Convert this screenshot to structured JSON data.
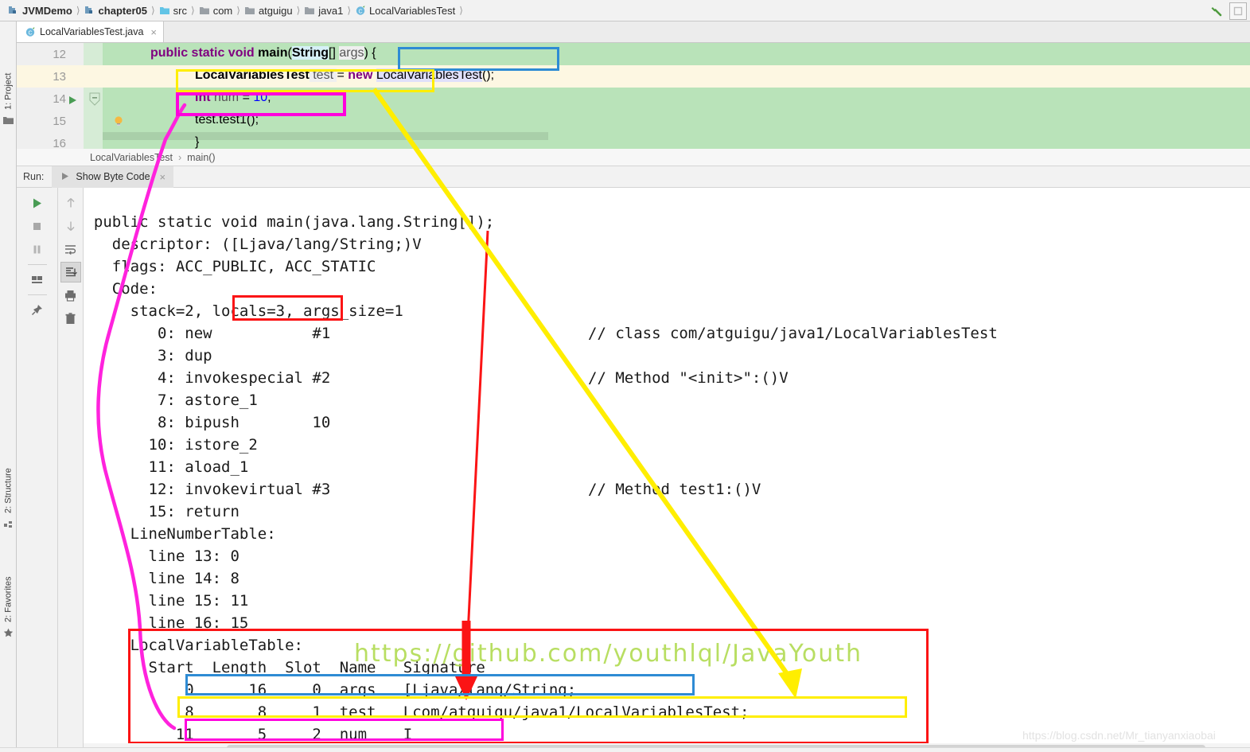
{
  "window": {
    "breadcrumb": [
      {
        "label": "JVMDemo",
        "icon": "module-icon",
        "bold": true
      },
      {
        "label": "chapter05",
        "icon": "module-icon",
        "bold": true
      },
      {
        "label": "src",
        "icon": "source-folder-icon",
        "bold": false
      },
      {
        "label": "com",
        "icon": "folder-icon",
        "bold": false
      },
      {
        "label": "atguigu",
        "icon": "folder-icon",
        "bold": false
      },
      {
        "label": "java1",
        "icon": "folder-icon",
        "bold": false
      },
      {
        "label": "LocalVariablesTest",
        "icon": "java-class-icon",
        "bold": false
      }
    ],
    "toolbar_right": [
      {
        "name": "build-hammer-icon"
      },
      {
        "name": "search-everywhere-icon"
      }
    ]
  },
  "left_stripe": [
    {
      "label": "1: Project",
      "icon": "project-icon"
    },
    {
      "label": "2: Structure",
      "icon": "structure-icon"
    },
    {
      "label": "2: Favorites",
      "icon": "star-icon"
    }
  ],
  "editor": {
    "tab": {
      "label": "LocalVariablesTest.java",
      "icon": "java-class-icon",
      "close": "×"
    },
    "lines": [
      {
        "number": "12",
        "text": "public static void main(String[] args) {"
      },
      {
        "number": "13",
        "text": "LocalVariablesTest test = new LocalVariablesTest();"
      },
      {
        "number": "14",
        "text": "int num = 10;"
      },
      {
        "number": "15",
        "text": "test.test1();"
      },
      {
        "number": "16",
        "text": "}"
      }
    ],
    "tokens": {
      "l12_kw1": "public static void ",
      "l12_name": "main",
      "l12_paren_open": "(",
      "l12_string": "String",
      "l12_brackets": "[] ",
      "l12_args": "args",
      "l12_paren_close": ")",
      "l12_brace": " {",
      "l13_type": "LocalVariablesTest",
      "l13_var": " test ",
      "l13_eq": "= ",
      "l13_new": "new ",
      "l13_ctor": "LocalVariablesTest",
      "l13_tail": "();",
      "l14_int": "int",
      "l14_var": " num ",
      "l14_eq": "= ",
      "l14_val": "10",
      "l14_semi": ";",
      "l15_text": "test.test1();",
      "l16_text": "}"
    },
    "breadcrumb": [
      "LocalVariablesTest",
      "main()"
    ],
    "gutter_icons": [
      {
        "name": "run-gutter-icon",
        "line": "12"
      },
      {
        "name": "fold-icon",
        "line": "12"
      },
      {
        "name": "intention-bulb-icon",
        "line": "13"
      }
    ]
  },
  "run_panel": {
    "label": "Run:",
    "tab_label": "Show Byte Code",
    "tab_close": "×",
    "toolbar_left": [
      {
        "name": "rerun-icon"
      },
      {
        "name": "stop-icon"
      },
      {
        "name": "pause-icon"
      },
      {
        "name": "layout-icon"
      },
      {
        "name": "pin-icon"
      }
    ],
    "toolbar_right": [
      {
        "name": "up-arrow-icon"
      },
      {
        "name": "down-arrow-icon"
      },
      {
        "name": "soft-wrap-icon"
      },
      {
        "name": "scroll-to-end-icon",
        "selected": true
      },
      {
        "name": "print-icon"
      },
      {
        "name": "trash-icon"
      }
    ]
  },
  "console": {
    "lines": [
      "{",
      "  public static void main(java.lang.String[]);",
      "    descriptor: ([Ljava/lang/String;)V",
      "    flags: ACC_PUBLIC, ACC_STATIC",
      "    Code:",
      "      stack=2, locals=3, args_size=1",
      "         0: new           #1",
      "         3: dup",
      "         4: invokespecial #2",
      "         7: astore_1",
      "         8: bipush        10",
      "        10: istore_2",
      "        11: aload_1",
      "        12: invokevirtual #3",
      "        15: return",
      "      LineNumberTable:",
      "        line 13: 0",
      "        line 14: 8",
      "        line 15: 11",
      "        line 16: 15",
      "      LocalVariableTable:",
      "        Start  Length  Slot  Name   Signature",
      "            0      16     0  args   [Ljava/lang/String;",
      "            8       8     1  test   Lcom/atguigu/java1/LocalVariablesTest;",
      "           11       5     2  num    I"
    ],
    "comments": [
      {
        "text": "// class com/atguigu/java1/LocalVariablesTest",
        "row": 6
      },
      {
        "text": "// Method \"<init>\":()V",
        "row": 8
      },
      {
        "text": "// Method test1:()V",
        "row": 13
      }
    ],
    "bytecode": {
      "stack": "stack=2,",
      "locals": "locals=3,",
      "args_size": "args_size=1",
      "instructions": [
        {
          "offset": "0:",
          "op": "new",
          "operand": "#1",
          "comment": "// class com/atguigu/java1/LocalVariablesTest"
        },
        {
          "offset": "3:",
          "op": "dup",
          "operand": "",
          "comment": ""
        },
        {
          "offset": "4:",
          "op": "invokespecial",
          "operand": "#2",
          "comment": "// Method \"<init>\":()V"
        },
        {
          "offset": "7:",
          "op": "astore_1",
          "operand": "",
          "comment": ""
        },
        {
          "offset": "8:",
          "op": "bipush",
          "operand": "10",
          "comment": ""
        },
        {
          "offset": "10:",
          "op": "istore_2",
          "operand": "",
          "comment": ""
        },
        {
          "offset": "11:",
          "op": "aload_1",
          "operand": "",
          "comment": ""
        },
        {
          "offset": "12:",
          "op": "invokevirtual",
          "operand": "#3",
          "comment": "// Method test1:()V"
        },
        {
          "offset": "15:",
          "op": "return",
          "operand": "",
          "comment": ""
        }
      ],
      "line_number_table": {
        "title": "LineNumberTable:",
        "rows": [
          "line 13: 0",
          "line 14: 8",
          "line 15: 11",
          "line 16: 15"
        ]
      },
      "local_variable_table": {
        "title": "LocalVariableTable:",
        "headers": [
          "Start",
          "Length",
          "Slot",
          "Name",
          "Signature"
        ],
        "rows": [
          {
            "start": "0",
            "length": "16",
            "slot": "0",
            "name": "args",
            "signature": "[Ljava/lang/String;"
          },
          {
            "start": "8",
            "length": "8",
            "slot": "1",
            "name": "test",
            "signature": "Lcom/atguigu/java1/LocalVariablesTest;"
          },
          {
            "start": "11",
            "length": "5",
            "slot": "2",
            "name": "num",
            "signature": "I"
          }
        ]
      }
    }
  },
  "annotations": {
    "colors": {
      "blue": "#2e8bd4",
      "yellow": "#ffee00",
      "magenta": "#ff00dd",
      "red": "#fb1415",
      "green_watermark": "#b5dd5a"
    },
    "boxes": [
      {
        "name": "blue-box-string-args",
        "color": "#2e8bd4"
      },
      {
        "name": "yellow-box-localvariablestest-test",
        "color": "#ffee00"
      },
      {
        "name": "magenta-box-int-num",
        "color": "#ff00dd"
      },
      {
        "name": "red-box-locals",
        "color": "#fb1415"
      },
      {
        "name": "red-box-localvariabletable",
        "color": "#fb1415"
      },
      {
        "name": "blue-box-args-row",
        "color": "#2e8bd4"
      },
      {
        "name": "yellow-box-test-row",
        "color": "#ffee00"
      },
      {
        "name": "magenta-box-num-row",
        "color": "#ff00dd"
      },
      {
        "name": "blue-box-args-signature",
        "color": "#2e8bd4"
      },
      {
        "name": "yellow-box-test-signature",
        "color": "#ffee00"
      },
      {
        "name": "magenta-box-num-signature",
        "color": "#ff00dd"
      }
    ]
  },
  "watermarks": {
    "github": "https://github.com/youthlql/JavaYouth",
    "csdn": "https://blog.csdn.net/Mr_tianyanxiaobai"
  }
}
